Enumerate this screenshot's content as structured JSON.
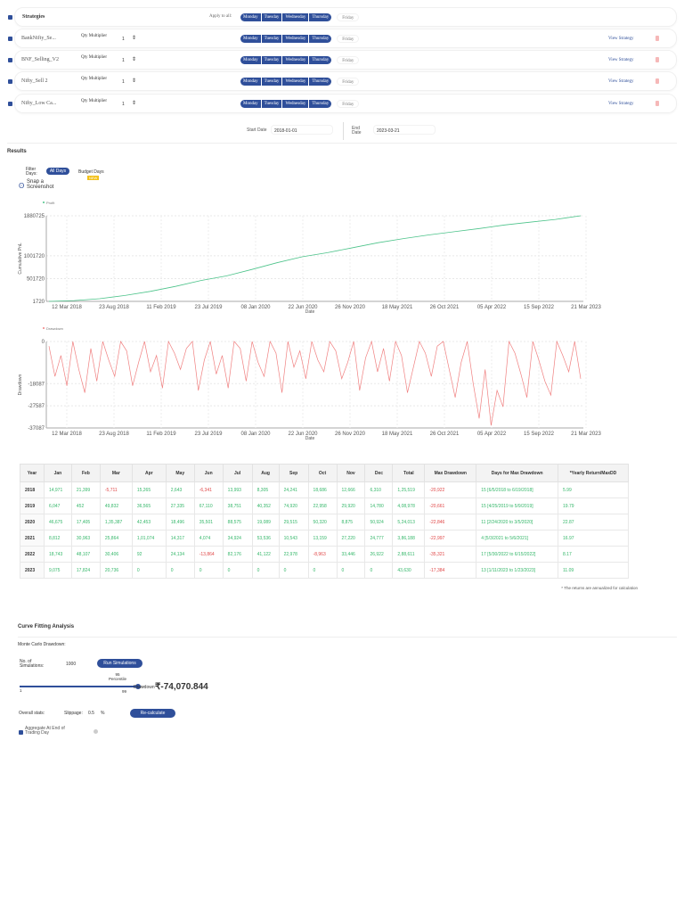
{
  "header": {
    "label": "Strategies",
    "apply_all": "Apply to all:",
    "days": [
      "Monday",
      "Tuesday",
      "Wednesday",
      "Thursday",
      "Friday"
    ]
  },
  "strategies": [
    {
      "name": "BankNifty_Se...",
      "qty_label": "Qty Multiplier",
      "qty": "1",
      "view": "View Strategy"
    },
    {
      "name": "BNF_Selling_V2",
      "qty_label": "Qty Multiplier",
      "qty": "1",
      "view": "View Strategy"
    },
    {
      "name": "Nifty_Sell 2",
      "qty_label": "Qty Multiplier",
      "qty": "1",
      "view": "View Strategy"
    },
    {
      "name": "Nifty_Low Ca...",
      "qty_label": "Qty Multiplier",
      "qty": "1",
      "view": "View Strategy"
    }
  ],
  "dates": {
    "start_label": "Start Date",
    "start": "2018-01-01",
    "end_label": "End Date",
    "end": "2023-03-21"
  },
  "results": {
    "title": "Results",
    "filter_label": "Filter Days:",
    "all_days": "All Days",
    "budget_days": "Budget Days",
    "new_badge": "NEW",
    "snap": "Snap a Screenshot"
  },
  "chart_data": [
    {
      "type": "line",
      "title": "",
      "legend": [
        "Profit"
      ],
      "xlabel": "Date",
      "ylabel": "Cumulative PnL",
      "color": "#4cc38a",
      "yticks": [
        "1880725",
        "1001720",
        "501720",
        "1720"
      ],
      "ylim": [
        1720,
        1880725
      ],
      "xticks": [
        "12 Mar 2018",
        "23 Aug 2018",
        "11 Feb 2019",
        "23 Jul 2019",
        "08 Jan 2020",
        "22 Jun 2020",
        "26 Nov 2020",
        "18 May 2021",
        "26 Oct 2021",
        "05 Apr 2022",
        "15 Sep 2022",
        "21 Mar 2023"
      ],
      "values": [
        1720,
        20000,
        60000,
        130000,
        220000,
        330000,
        460000,
        560000,
        700000,
        850000,
        980000,
        1070000,
        1180000,
        1290000,
        1380000,
        1460000,
        1530000,
        1600000,
        1680000,
        1740000,
        1800000,
        1880725
      ]
    },
    {
      "type": "line",
      "title": "",
      "legend": [
        "Drawdown"
      ],
      "xlabel": "Date",
      "ylabel": "Drawdown",
      "color": "#f08080",
      "yticks": [
        "0",
        "-18087",
        "-27587",
        "-37087"
      ],
      "ylim": [
        -37087,
        0
      ],
      "xticks": [
        "12 Mar 2018",
        "23 Aug 2018",
        "11 Feb 2019",
        "23 Jul 2019",
        "08 Jan 2020",
        "22 Jun 2020",
        "26 Nov 2020",
        "18 May 2021",
        "26 Oct 2021",
        "05 Apr 2022",
        "15 Sep 2022",
        "21 Mar 2023"
      ],
      "values": [
        -2000,
        -15000,
        -6000,
        -19000,
        0,
        -12000,
        -22000,
        -3000,
        -17000,
        0,
        -8000,
        -15000,
        0,
        -4000,
        -19000,
        -9000,
        0,
        -13000,
        -6000,
        -20000,
        0,
        -5000,
        -12000,
        -3000,
        0,
        -21000,
        -8000,
        0,
        -14000,
        -6000,
        -20000,
        0,
        -3000,
        -17000,
        0,
        -9000,
        -15000,
        0,
        -5000,
        -22000,
        0,
        -11000,
        -4000,
        -16000,
        0,
        -8000,
        -13000,
        0,
        -4000,
        -16000,
        -9000,
        0,
        -21000,
        -7000,
        0,
        -13000,
        -3000,
        -17000,
        0,
        -6000,
        -22000,
        -11000,
        0,
        -5000,
        -15000,
        -2000,
        0,
        -12000,
        -24000,
        -9000,
        0,
        -18000,
        -33000,
        -12000,
        -36000,
        -21000,
        -28000,
        0,
        -5000,
        -14000,
        -24000,
        0,
        -8000,
        -17000,
        -23000,
        0,
        -6000,
        -13000,
        0,
        -16000
      ]
    }
  ],
  "table": {
    "headers": [
      "Year",
      "Jan",
      "Feb",
      "Mar",
      "Apr",
      "May",
      "Jun",
      "Jul",
      "Aug",
      "Sep",
      "Oct",
      "Nov",
      "Dec",
      "Total",
      "Max Drawdown",
      "Days for Max Drawdown",
      "*Yearly Return/MaxDD"
    ],
    "rows": [
      [
        "2018",
        "14,971",
        "21,399",
        "-5,711",
        "15,265",
        "2,643",
        "-6,341",
        "13,993",
        "8,305",
        "24,241",
        "18,686",
        "12,666",
        "6,310",
        "1,25,519",
        "-20,922",
        "15 [6/5/2018 to 6/19/2018]",
        "5.99"
      ],
      [
        "2019",
        "6,047",
        "452",
        "49,832",
        "36,565",
        "27,335",
        "67,110",
        "38,751",
        "40,352",
        "74,920",
        "22,958",
        "29,920",
        "14,780",
        "4,08,978",
        "-20,661",
        "15 [4/25/2019 to 5/9/2019]",
        "19.79"
      ],
      [
        "2020",
        "46,675",
        "17,405",
        "1,35,387",
        "42,453",
        "18,496",
        "35,501",
        "88,575",
        "19,089",
        "29,515",
        "50,320",
        "8,875",
        "50,924",
        "5,24,013",
        "-22,846",
        "11 [2/24/2020 to 3/5/2020]",
        "22.87"
      ],
      [
        "2021",
        "8,812",
        "30,963",
        "25,864",
        "1,01,074",
        "14,317",
        "4,074",
        "34,924",
        "53,536",
        "10,543",
        "13,159",
        "27,220",
        "24,777",
        "3,86,188",
        "-22,997",
        "4 [5/3/2021 to 5/6/2021]",
        "16.97"
      ],
      [
        "2022",
        "18,743",
        "48,107",
        "30,406",
        "92",
        "24,134",
        "-13,864",
        "82,176",
        "41,122",
        "22,978",
        "-8,963",
        "33,446",
        "26,922",
        "2,88,611",
        "-35,321",
        "17 [5/30/2022 to 6/15/2022]",
        "8.17"
      ],
      [
        "2023",
        "9,075",
        "17,824",
        "20,736",
        "0",
        "0",
        "0",
        "0",
        "0",
        "0",
        "0",
        "0",
        "0",
        "43,630",
        "-17,384",
        "13 [1/11/2023 to 1/23/2023]",
        "11.09"
      ]
    ],
    "note": "* The returns are annualized for calculation"
  },
  "curve": {
    "title": "Curve Fitting Analysis",
    "monte_carlo": "Monte Carlo Drawdown:",
    "num_label": "No. of Simulations:",
    "num": "1000",
    "run": "Run Simulations",
    "percentile": "95 Percentile",
    "min": "1",
    "max": "99",
    "percentile_value": 95,
    "dd_label": "Drawdown",
    "dd_value": "₹-74,070.844",
    "overall": "Overall stats:",
    "slippage_label": "Slippage:",
    "slippage": "0.5",
    "pct": "%",
    "recalc": "Re-calculate",
    "aggregate": "Aggregate At End of Trading Day"
  }
}
